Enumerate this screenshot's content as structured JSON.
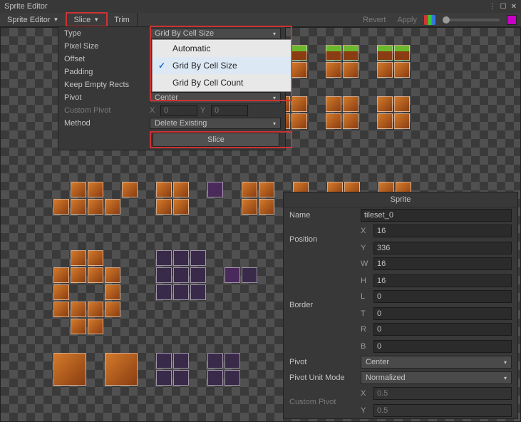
{
  "window": {
    "title": "Sprite Editor"
  },
  "toolbar": {
    "mode": "Sprite Editor",
    "slice": "Slice",
    "trim": "Trim",
    "revert": "Revert",
    "apply": "Apply"
  },
  "slice_panel": {
    "type_label": "Type",
    "type_value": "Grid By Cell Size",
    "type_options": [
      "Automatic",
      "Grid By Cell Size",
      "Grid By Cell Count"
    ],
    "pixel_size_label": "Pixel Size",
    "offset_label": "Offset",
    "padding_label": "Padding",
    "keep_empty_label": "Keep Empty Rects",
    "pivot_label": "Pivot",
    "pivot_value": "Center",
    "custom_pivot_label": "Custom Pivot",
    "custom_pivot_x": "0",
    "custom_pivot_y": "0",
    "method_label": "Method",
    "method_value": "Delete Existing",
    "slice_button": "Slice"
  },
  "inspector": {
    "header": "Sprite",
    "name_label": "Name",
    "name_value": "tileset_0",
    "position_label": "Position",
    "pos_x": "16",
    "pos_y": "336",
    "pos_w": "16",
    "pos_h": "16",
    "border_label": "Border",
    "border_l": "0",
    "border_t": "0",
    "border_r": "0",
    "border_b": "0",
    "pivot_label": "Pivot",
    "pivot_value": "Center",
    "pivot_unit_label": "Pivot Unit Mode",
    "pivot_unit_value": "Normalized",
    "custom_pivot_label": "Custom Pivot",
    "cpivot_x": "0.5",
    "cpivot_y": "0.5"
  }
}
